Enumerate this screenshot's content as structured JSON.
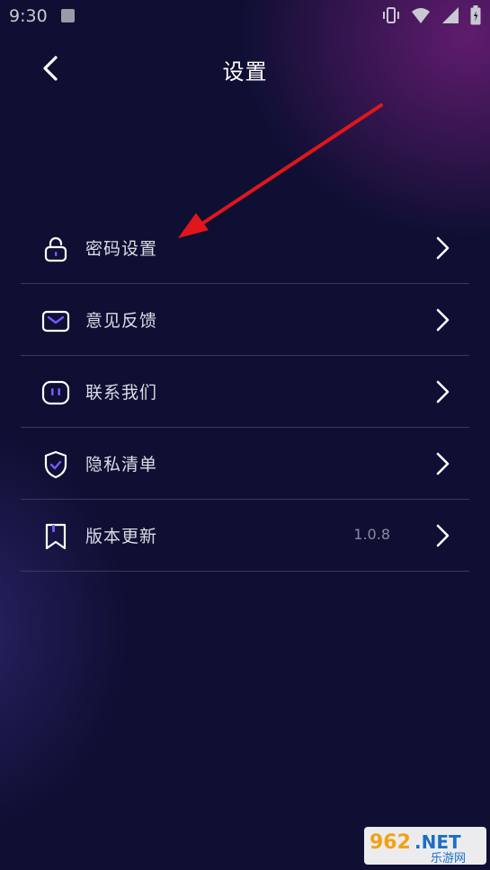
{
  "status_bar": {
    "time": "9:30",
    "icons": [
      "notification-icon",
      "vibrate-icon",
      "wifi-icon",
      "signal-icon",
      "battery-icon"
    ]
  },
  "header": {
    "title": "设置",
    "back_icon": "back-arrow-icon"
  },
  "menu": {
    "items": [
      {
        "label": "密码设置",
        "icon": "lock-icon",
        "value": ""
      },
      {
        "label": "意见反馈",
        "icon": "mail-icon",
        "value": ""
      },
      {
        "label": "联系我们",
        "icon": "chat-icon",
        "value": ""
      },
      {
        "label": "隐私清单",
        "icon": "shield-icon",
        "value": ""
      },
      {
        "label": "版本更新",
        "icon": "bookmark-icon",
        "value": "1.0.8"
      }
    ]
  },
  "watermark": {
    "brand": "962.NET",
    "sub": "乐游网"
  },
  "colors": {
    "background": "#0f0f33",
    "accent": "#6f5cff",
    "divider": "#3a3a5e",
    "annotation_arrow": "#e0161b"
  }
}
